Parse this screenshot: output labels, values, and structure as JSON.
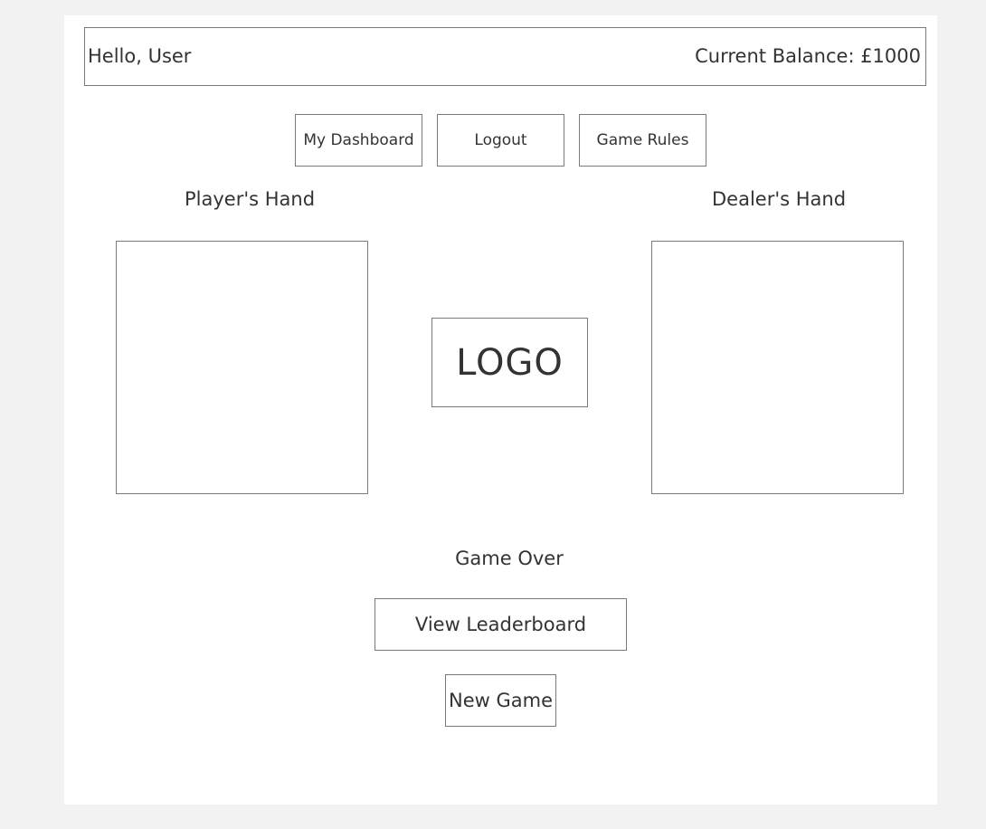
{
  "header": {
    "greeting": "Hello, User",
    "balance": "Current Balance: £1000"
  },
  "nav": {
    "dashboard_label": "My Dashboard",
    "logout_label": "Logout",
    "rules_label": "Game Rules"
  },
  "game": {
    "player_hand_title": "Player's Hand",
    "dealer_hand_title": "Dealer's Hand",
    "logo_text": "LOGO",
    "status": "Game Over"
  },
  "actions": {
    "leaderboard_label": "View Leaderboard",
    "new_game_label": "New Game"
  }
}
